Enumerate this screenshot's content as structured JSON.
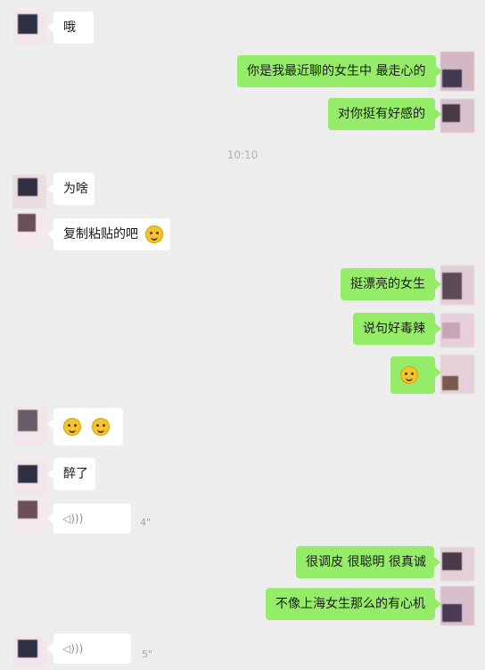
{
  "chat": {
    "messages": [
      {
        "side": "left",
        "type": "text",
        "text": "哦"
      },
      {
        "side": "right",
        "type": "text",
        "text": "你是我最近聊的女生中 最走心的"
      },
      {
        "side": "right",
        "type": "text",
        "text": "对你挺有好感的"
      },
      {
        "type": "timestamp",
        "text": "10:10"
      },
      {
        "side": "left",
        "type": "text",
        "text": "为啥"
      },
      {
        "side": "left",
        "type": "text_emoji",
        "text": "复制粘贴的吧",
        "emoji": "thinking-emoji"
      },
      {
        "side": "right",
        "type": "text",
        "text": "挺漂亮的女生"
      },
      {
        "side": "right",
        "type": "text",
        "text": "说句好毒辣"
      },
      {
        "side": "right",
        "type": "emoji",
        "emoji": "laughing-emoji"
      },
      {
        "side": "left",
        "type": "emoji_pair",
        "emoji": [
          "sad-emoji",
          "sad-emoji"
        ]
      },
      {
        "side": "left",
        "type": "text",
        "text": "醉了"
      },
      {
        "side": "left",
        "type": "voice",
        "duration": "4\""
      },
      {
        "side": "right",
        "type": "text",
        "text": "很调皮 很聪明 很真诚"
      },
      {
        "side": "right",
        "type": "text",
        "text": "不像上海女生那么的有心机"
      },
      {
        "side": "left",
        "type": "voice",
        "duration": "5\""
      }
    ]
  },
  "colors": {
    "background": "#ededed",
    "incoming_bubble": "#ffffff",
    "outgoing_bubble": "#95ec69",
    "timestamp": "#b3b3b3"
  }
}
